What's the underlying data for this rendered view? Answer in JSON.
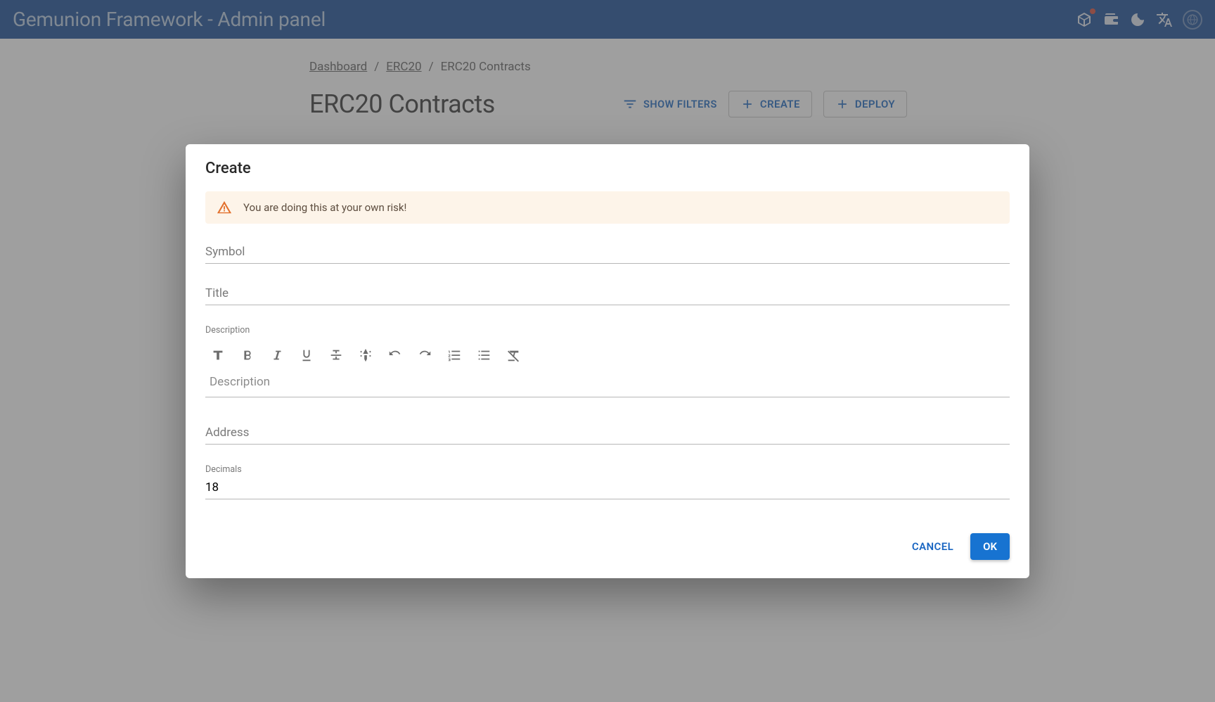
{
  "appbar": {
    "title": "Gemunion Framework - Admin panel"
  },
  "breadcrumb": {
    "items": [
      "Dashboard",
      "ERC20"
    ],
    "current": "ERC20 Contracts"
  },
  "page": {
    "title": "ERC20 Contracts",
    "show_filters": "SHOW FILTERS",
    "create": "CREATE",
    "deploy": "DEPLOY"
  },
  "dialog": {
    "title": "Create",
    "alert": "You are doing this at your own risk!",
    "fields": {
      "symbol_placeholder": "Symbol",
      "title_placeholder": "Title",
      "description_label": "Description",
      "description_placeholder": "Description",
      "address_placeholder": "Address",
      "decimals_label": "Decimals",
      "decimals_value": "18"
    },
    "actions": {
      "cancel": "CANCEL",
      "ok": "OK"
    }
  }
}
